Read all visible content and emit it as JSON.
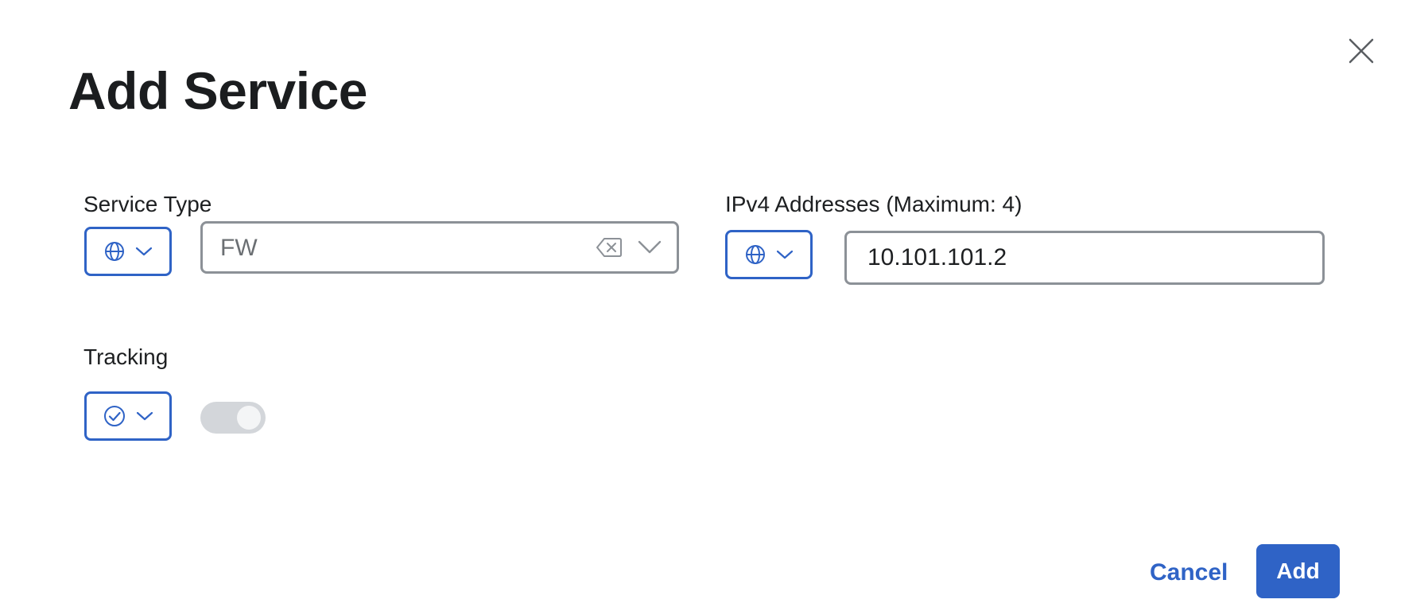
{
  "dialog": {
    "title": "Add Service",
    "close_icon": "close-icon"
  },
  "service_type": {
    "label": "Service Type",
    "variable_icon": "globe-icon",
    "value": "FW",
    "clear_icon": "clear-icon",
    "dropdown_icon": "chevron-down-icon"
  },
  "ipv4": {
    "label": "IPv4 Addresses (Maximum: 4)",
    "variable_icon": "globe-icon",
    "value": "10.101.101.2"
  },
  "tracking": {
    "label": "Tracking",
    "variable_icon": "check-circle-icon",
    "enabled": false
  },
  "footer": {
    "cancel_label": "Cancel",
    "add_label": "Add"
  },
  "colors": {
    "accent": "#2f63c6",
    "border": "#8c9197",
    "toggle_off": "#d3d6da"
  }
}
